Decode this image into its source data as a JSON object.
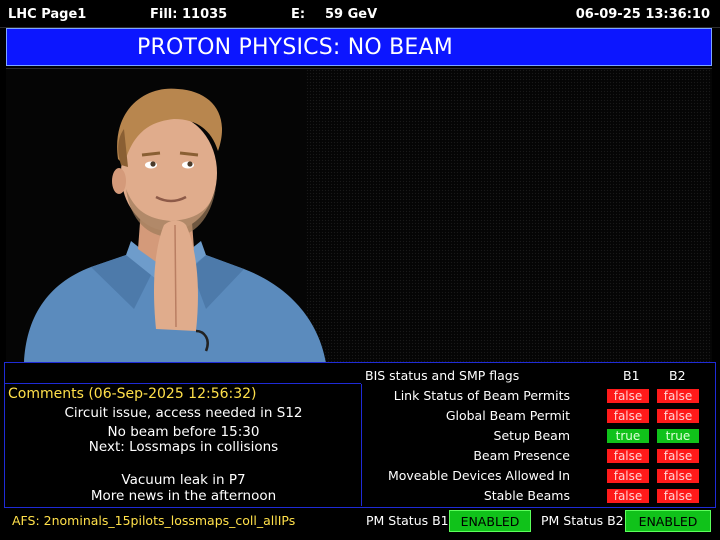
{
  "top_bar": {
    "page": "LHC Page1",
    "fill": "Fill: 11035",
    "energy_label": "E:",
    "energy_value": "59 GeV",
    "datetime": "06-09-25 13:36:10"
  },
  "banner": {
    "text": "PROTON PHYSICS: NO BEAM"
  },
  "comments": {
    "title": "Comments (06-Sep-2025 12:56:32)",
    "lines": [
      "Circuit issue, access needed in S12",
      "No beam before 15:30",
      "Next: Lossmaps in collisions",
      "",
      "Vacuum leak in P7",
      "More news in the afternoon"
    ]
  },
  "bis": {
    "title": "BIS status and SMP flags",
    "col_b1": "B1",
    "col_b2": "B2",
    "rows": [
      {
        "label": "Link Status of Beam Permits",
        "b1": "false",
        "b2": "false"
      },
      {
        "label": "Global Beam Permit",
        "b1": "false",
        "b2": "false"
      },
      {
        "label": "Setup Beam",
        "b1": "true",
        "b2": "true"
      },
      {
        "label": "Beam Presence",
        "b1": "false",
        "b2": "false"
      },
      {
        "label": "Moveable Devices Allowed In",
        "b1": "false",
        "b2": "false"
      },
      {
        "label": "Stable Beams",
        "b1": "false",
        "b2": "false"
      }
    ]
  },
  "bottom_bar": {
    "afs": "AFS: 2nominals_15pilots_lossmaps_coll_allIPs",
    "pm_b1_label": "PM Status B1",
    "pm_b1_state": "ENABLED",
    "pm_b2_label": "PM Status B2",
    "pm_b2_state": "ENABLED"
  },
  "colors": {
    "banner": "#0c16ff",
    "panel_border": "#1f2bd6",
    "highlight_text": "#ffe04a",
    "flag_false": "#ff1a1a",
    "flag_true": "#10c21a"
  }
}
